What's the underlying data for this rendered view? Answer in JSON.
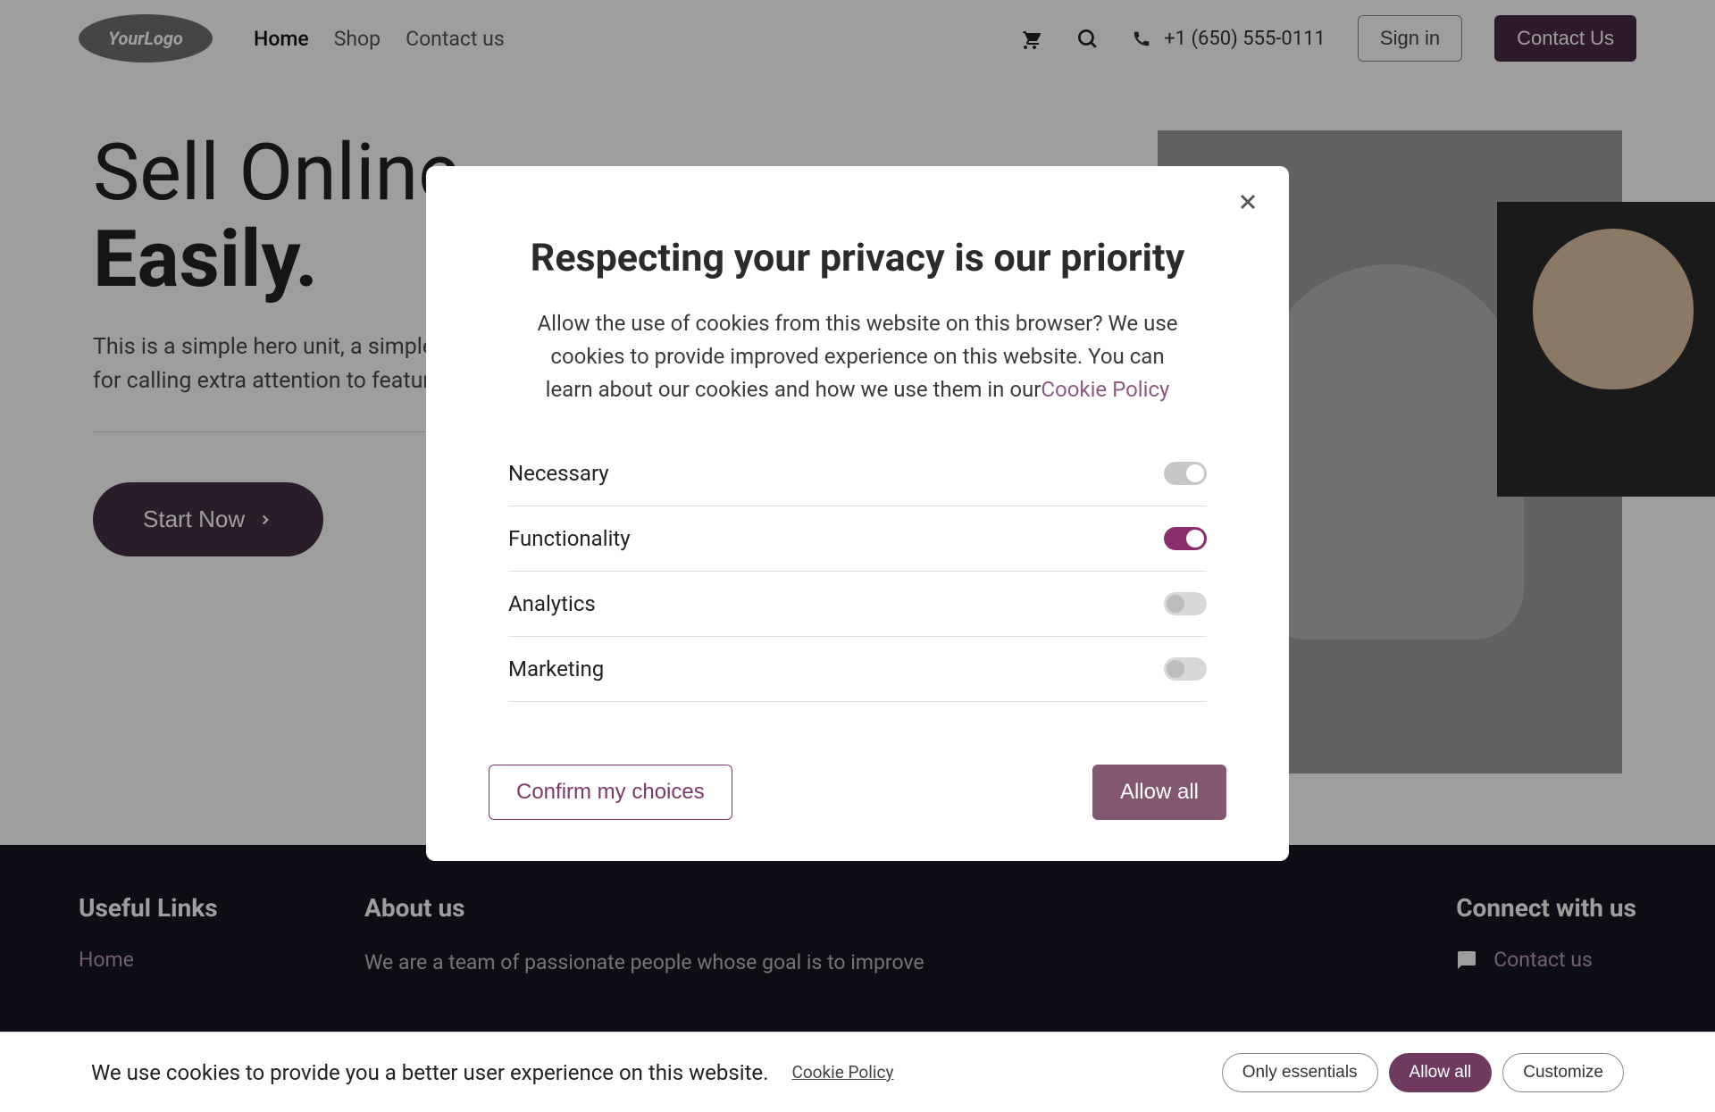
{
  "header": {
    "logo_text": "YourLogo",
    "nav": [
      {
        "label": "Home",
        "active": true
      },
      {
        "label": "Shop",
        "active": false
      },
      {
        "label": "Contact us",
        "active": false
      }
    ],
    "phone": "+1 (650) 555-0111",
    "sign_in": "Sign in",
    "contact_btn": "Contact Us"
  },
  "hero": {
    "title_line1": "Sell Online.",
    "title_line2": "Easily.",
    "subtitle": "This is a simple hero unit, a simple jumbotron-style component for calling extra attention to featured content or information.",
    "cta": "Start Now"
  },
  "footer": {
    "links_heading": "Useful Links",
    "links": [
      "Home"
    ],
    "about_heading": "About us",
    "about_text": "We are a team of passionate people whose goal is to improve",
    "connect_heading": "Connect with us",
    "connect_link": "Contact us"
  },
  "cookie_bar": {
    "text": "We use cookies to provide you a better user experience on this website.",
    "link": "Cookie Policy",
    "only_essentials": "Only essentials",
    "allow_all": "Allow all",
    "customize": "Customize"
  },
  "modal": {
    "title": "Respecting your privacy is our priority",
    "desc_before": "Allow the use of cookies from this website on this browser? We use cookies to provide improved experience on this website. You can learn about our cookies and how we use them in our",
    "desc_link": "Cookie Policy",
    "rows": [
      {
        "label": "Necessary",
        "state": "locked"
      },
      {
        "label": "Functionality",
        "state": "on"
      },
      {
        "label": "Analytics",
        "state": "off"
      },
      {
        "label": "Marketing",
        "state": "off"
      }
    ],
    "confirm": "Confirm my choices",
    "allow_all": "Allow all"
  }
}
